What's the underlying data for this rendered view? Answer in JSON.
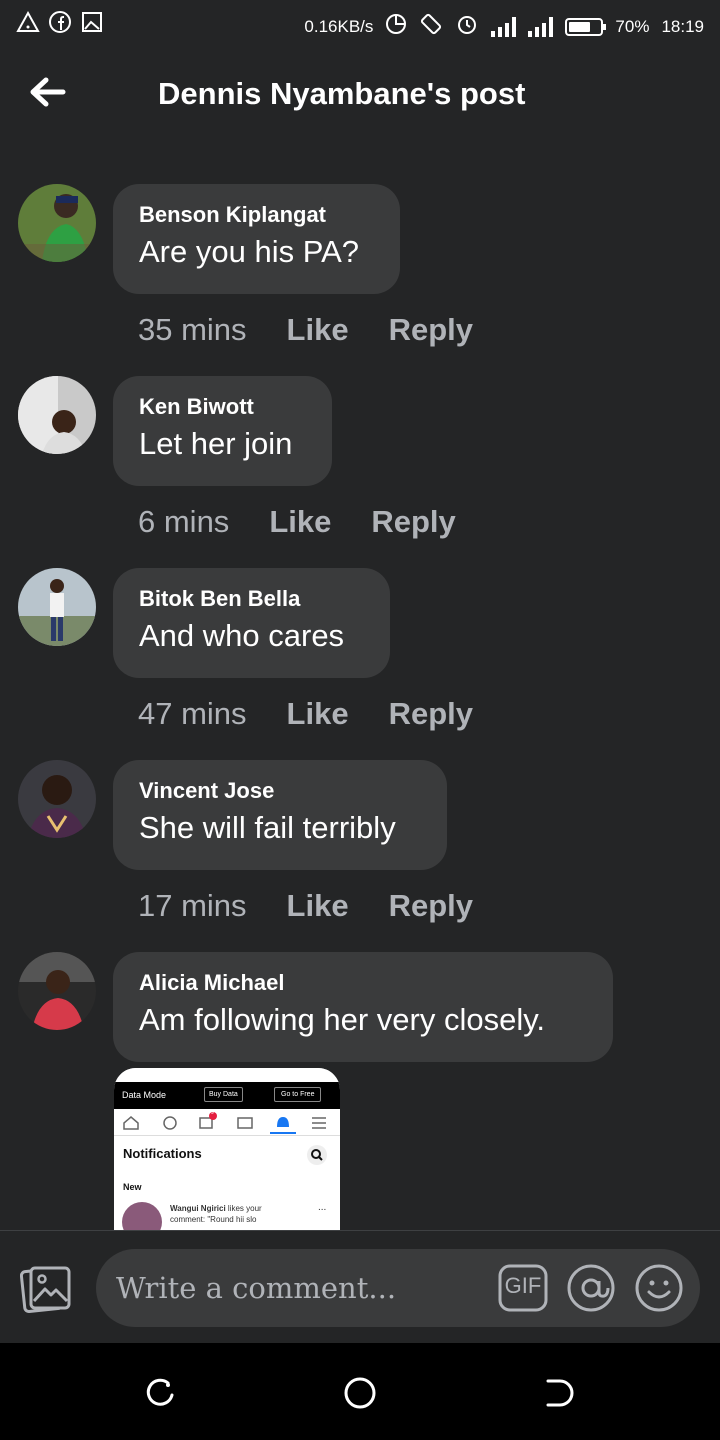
{
  "status_bar": {
    "left_icons": [
      "warning-icon",
      "facebook-icon",
      "image-icon"
    ],
    "speed": "0.16KB/s",
    "battery_percent": "70%",
    "battery_level": 0.7,
    "time": "18:19"
  },
  "header": {
    "title": "Dennis Nyambane's post"
  },
  "comments": [
    {
      "author": "Benson Kiplangat",
      "text": "Are you his PA?",
      "time": "35 mins",
      "like": "Like",
      "reply": "Reply"
    },
    {
      "author": "Ken Biwott",
      "text": "Let her join",
      "time": "6 mins",
      "like": "Like",
      "reply": "Reply"
    },
    {
      "author": "Bitok Ben Bella",
      "text": "And who cares",
      "time": "47 mins",
      "like": "Like",
      "reply": "Reply"
    },
    {
      "author": "Vincent Jose",
      "text": "She will fail terribly",
      "time": "17 mins",
      "like": "Like",
      "reply": "Reply"
    },
    {
      "author": "Alicia Michael",
      "text": "Am following her very closely.",
      "time": "",
      "like": "",
      "reply": ""
    }
  ],
  "attachment": {
    "topbar_label": "Data Mode",
    "buy_data": "Buy Data",
    "go_free": "Go to Free",
    "notif_badge": "9",
    "heading": "Notifications",
    "section": "New",
    "item_name": "Wangui Ngirici",
    "item_text": " likes your",
    "item_text2": "comment: \"Round hii slo",
    "more": "..."
  },
  "composer": {
    "placeholder": "Write a comment...",
    "gif_label": "GIF"
  },
  "colors": {
    "background": "#242526",
    "bubble": "#3a3b3c",
    "secondary_text": "#b0b3b8"
  }
}
